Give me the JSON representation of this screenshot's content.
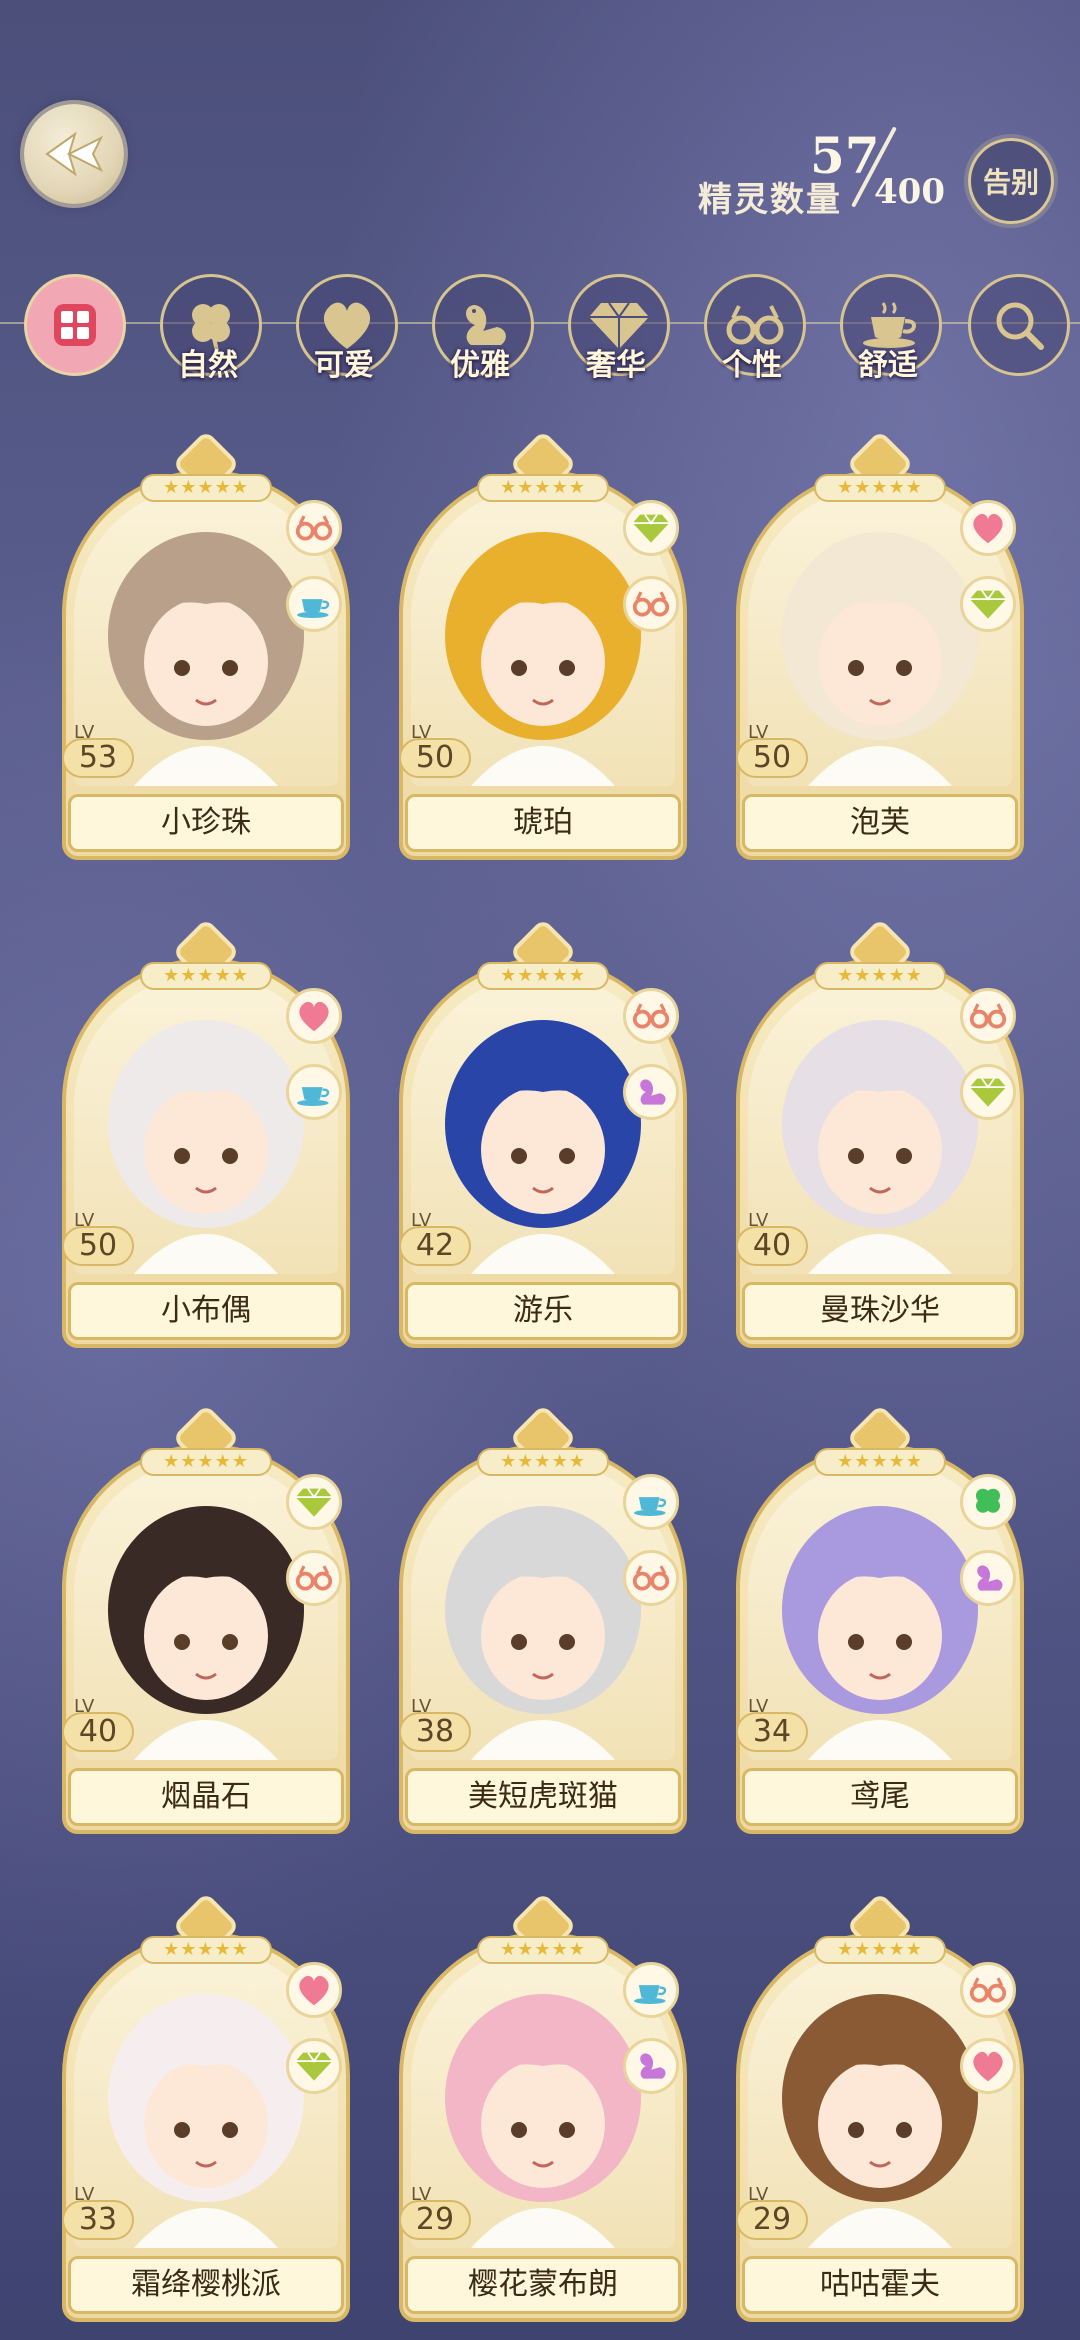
{
  "header": {
    "count_label": "精灵数量",
    "count_current": "57",
    "count_max": "400",
    "farewell_label": "告别"
  },
  "filters": [
    {
      "id": "all",
      "label": "",
      "icon": "grid-icon"
    },
    {
      "id": "nature",
      "label": "自然",
      "icon": "clover-icon"
    },
    {
      "id": "cute",
      "label": "可爱",
      "icon": "heart-icon"
    },
    {
      "id": "elegant",
      "label": "优雅",
      "icon": "swan-icon"
    },
    {
      "id": "luxury",
      "label": "奢华",
      "icon": "diamond-icon"
    },
    {
      "id": "personality",
      "label": "个性",
      "icon": "glasses-icon"
    },
    {
      "id": "comfort",
      "label": "舒适",
      "icon": "teacup-icon"
    },
    {
      "id": "search",
      "label": "",
      "icon": "search-icon"
    }
  ],
  "colors": {
    "heart": "#f07a93",
    "diamond": "#a9c83c",
    "glasses": "#e9836a",
    "teacup": "#4fb8d6",
    "swan": "#c777d8",
    "clover": "#3fbf55"
  },
  "spirits": [
    {
      "name": "小珍珠",
      "level_label": "LV",
      "level": "53",
      "stars": "★★★★★",
      "traits": [
        "glasses-icon",
        "teacup-icon"
      ],
      "hair": "#b8a08a"
    },
    {
      "name": "琥珀",
      "level_label": "LV",
      "level": "50",
      "stars": "★★★★★",
      "traits": [
        "diamond-icon",
        "glasses-icon"
      ],
      "hair": "#e8b02c"
    },
    {
      "name": "泡芙",
      "level_label": "LV",
      "level": "50",
      "stars": "★★★★★",
      "traits": [
        "heart-icon",
        "diamond-icon"
      ],
      "hair": "#f2e8d4"
    },
    {
      "name": "小布偶",
      "level_label": "LV",
      "level": "50",
      "stars": "★★★★★",
      "traits": [
        "heart-icon",
        "teacup-icon"
      ],
      "hair": "#eeeaea"
    },
    {
      "name": "游乐",
      "level_label": "LV",
      "level": "42",
      "stars": "★★★★★",
      "traits": [
        "glasses-icon",
        "swan-icon"
      ],
      "hair": "#2a45a8"
    },
    {
      "name": "曼珠沙华",
      "level_label": "LV",
      "level": "40",
      "stars": "★★★★★",
      "traits": [
        "glasses-icon",
        "diamond-icon"
      ],
      "hair": "#e6e0e6"
    },
    {
      "name": "烟晶石",
      "level_label": "LV",
      "level": "40",
      "stars": "★★★★★",
      "traits": [
        "diamond-icon",
        "glasses-icon"
      ],
      "hair": "#3a2a26"
    },
    {
      "name": "美短虎斑猫",
      "level_label": "LV",
      "level": "38",
      "stars": "★★★★★",
      "traits": [
        "teacup-icon",
        "glasses-icon"
      ],
      "hair": "#d8d8d8"
    },
    {
      "name": "鸢尾",
      "level_label": "LV",
      "level": "34",
      "stars": "★★★★★",
      "traits": [
        "clover-icon",
        "swan-icon"
      ],
      "hair": "#a99ae0"
    },
    {
      "name": "霜绛樱桃派",
      "level_label": "LV",
      "level": "33",
      "stars": "★★★★★",
      "traits": [
        "heart-icon",
        "diamond-icon"
      ],
      "hair": "#f6eeee"
    },
    {
      "name": "樱花蒙布朗",
      "level_label": "LV",
      "level": "29",
      "stars": "★★★★★",
      "traits": [
        "teacup-icon",
        "swan-icon"
      ],
      "hair": "#f2b6c6"
    },
    {
      "name": "咕咕霍夫",
      "level_label": "LV",
      "level": "29",
      "stars": "★★★★★",
      "traits": [
        "glasses-icon",
        "heart-icon"
      ],
      "hair": "#8a5a34"
    }
  ]
}
